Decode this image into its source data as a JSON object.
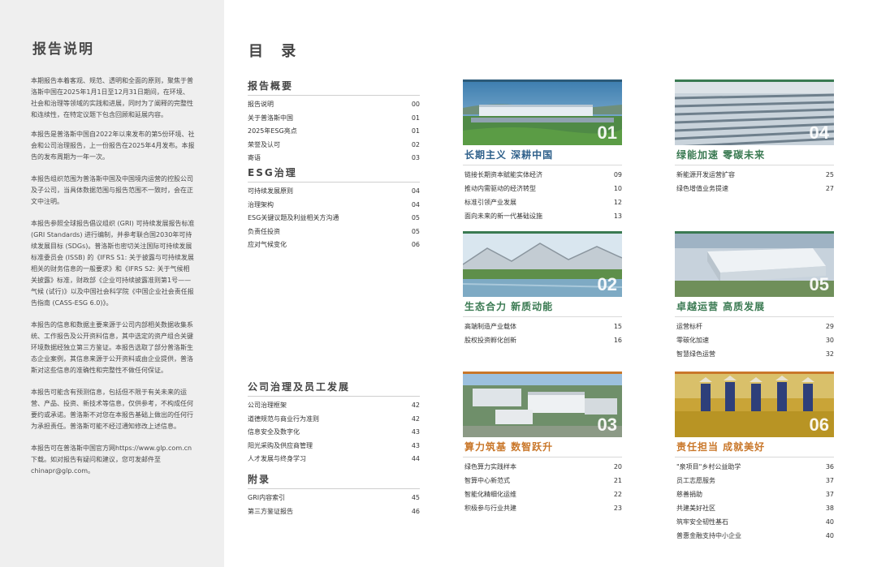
{
  "left_panel": {
    "title": "报告说明",
    "paragraphs": [
      "本期报告本着客观、规范、透明和全面的原则，聚焦于普洛斯中国在2025年1月1日至12月31日期间，在环境、社会和治理等领域的实践和进展，同时为了阐释的完整性和连续性，在特定议题下包含回顾和延展内容。",
      "本报告是普洛斯中国自2022年以来发布的第5份环境、社会和公司治理报告，上一份报告在2025年4月发布。本报告的发布周期为一年一次。",
      "本报告组织范围为普洛斯中国及中国境内运营的控股公司及子公司，当具体数据范围与报告范围不一致时，会在正文中注明。",
      "本报告参照全球报告倡议组织 (GRI) 可持续发展报告标准 (GRI Standards) 进行编制，并参考联合国2030年可持续发展目标 (SDGs)。普洛斯也密切关注国际可持续发展标准委员会 (ISSB) 的《IFRS S1: 关于披露与可持续发展相关的财务信息的一般要求》和《IFRS S2: 关于气候相关披露》标准，财政部《企业可持续披露准则第1号——气候 (试行)》以及中国社会科学院《中国企业社会责任报告指南 (CASS-ESG 6.0)》。",
      "本报告的信息和数据主要来源于公司内部相关数据收集系统、工作报告及公开资料信息，其中选定的资产组合关键环境数据经独立第三方鉴证。本报告选取了部分普洛斯生态企业案例，其信息来源于公开资料或由企业提供，普洛斯对这些信息的准确性和完整性不做任何保证。",
      "本报告可能含有预测信息，包括但不限于有关未来的运营、产品、投资、新技术等信息，仅供参考，不构成任何要约或承诺。普洛斯不对您在本报告基础上做出的任何行为承担责任。普洛斯可能不经过通知修改上述信息。",
      "本报告可在普洛斯中国官方网https://www.glp.com.cn下载。如对报告有疑问和建议，您可发邮件至chinapr@glp.com。"
    ]
  },
  "toc": {
    "title": "目 录",
    "sections": [
      {
        "title": "报告概要",
        "items": [
          {
            "label": "报告说明",
            "page": "00"
          },
          {
            "label": "关于普洛斯中国",
            "page": "01"
          },
          {
            "label": "2025年ESG亮点",
            "page": "01"
          },
          {
            "label": "荣誉及认可",
            "page": "02"
          },
          {
            "label": "寄语",
            "page": "03"
          }
        ]
      },
      {
        "title": "ESG治理",
        "items": [
          {
            "label": "可持续发展原则",
            "page": "04"
          },
          {
            "label": "治理架构",
            "page": "04"
          },
          {
            "label": "ESG关键议题及利益相关方沟通",
            "page": "05"
          },
          {
            "label": "负责任投资",
            "page": "05"
          },
          {
            "label": "应对气候变化",
            "page": "06"
          }
        ]
      },
      {
        "title": "公司治理及员工发展",
        "items": [
          {
            "label": "公司治理框架",
            "page": "42"
          },
          {
            "label": "道德规范与商业行为准则",
            "page": "42"
          },
          {
            "label": "信息安全及数字化",
            "page": "43"
          },
          {
            "label": "阳光采购及供应商管理",
            "page": "43"
          },
          {
            "label": "人才发展与终身学习",
            "page": "44"
          }
        ]
      },
      {
        "title": "附录",
        "items": [
          {
            "label": "GRI内容索引",
            "page": "45"
          },
          {
            "label": "第三方鉴证报告",
            "page": "46"
          }
        ]
      }
    ]
  },
  "chapters": [
    {
      "num": "01",
      "title": "长期主义 深耕中国",
      "items": [
        {
          "label": "链接长期资本赋能实体经济",
          "page": "09"
        },
        {
          "label": "推动内需驱动的经济转型",
          "page": "10"
        },
        {
          "label": "标准引领产业发展",
          "page": "12"
        },
        {
          "label": "面向未来的新一代基础设施",
          "page": "13"
        }
      ]
    },
    {
      "num": "02",
      "title": "生态合力 新质动能",
      "items": [
        {
          "label": "高端制造产业载体",
          "page": "15"
        },
        {
          "label": "股权投资孵化创新",
          "page": "16"
        }
      ]
    },
    {
      "num": "03",
      "title": "算力筑基 数智跃升",
      "items": [
        {
          "label": "绿色算力实践样本",
          "page": "20"
        },
        {
          "label": "智算中心新范式",
          "page": "21"
        },
        {
          "label": "智能化精细化运维",
          "page": "22"
        },
        {
          "label": "积极参与行业共建",
          "page": "23"
        }
      ]
    },
    {
      "num": "04",
      "title": "绿能加速 零碳未来",
      "items": [
        {
          "label": "新能源开发运营扩容",
          "page": "25"
        },
        {
          "label": "绿色增值业务提速",
          "page": "27"
        }
      ]
    },
    {
      "num": "05",
      "title": "卓越运营 高质发展",
      "items": [
        {
          "label": "运营标杆",
          "page": "29"
        },
        {
          "label": "零碳化加速",
          "page": "30"
        },
        {
          "label": "智慧绿色运营",
          "page": "32"
        }
      ]
    },
    {
      "num": "06",
      "title": "责任担当 成就美好",
      "items": [
        {
          "label": "\"泉项目\"乡村公益助学",
          "page": "36"
        },
        {
          "label": "员工志愿服务",
          "page": "37"
        },
        {
          "label": "慈善捐助",
          "page": "37"
        },
        {
          "label": "共建美好社区",
          "page": "38"
        },
        {
          "label": "筑牢安全韧性基石",
          "page": "40"
        },
        {
          "label": "普惠金融支持中小企业",
          "page": "40"
        }
      ]
    }
  ],
  "colors": {
    "blue": "#2d5f8a",
    "green": "#3a7a52",
    "orange": "#c9772a",
    "panel": "#efefef"
  }
}
